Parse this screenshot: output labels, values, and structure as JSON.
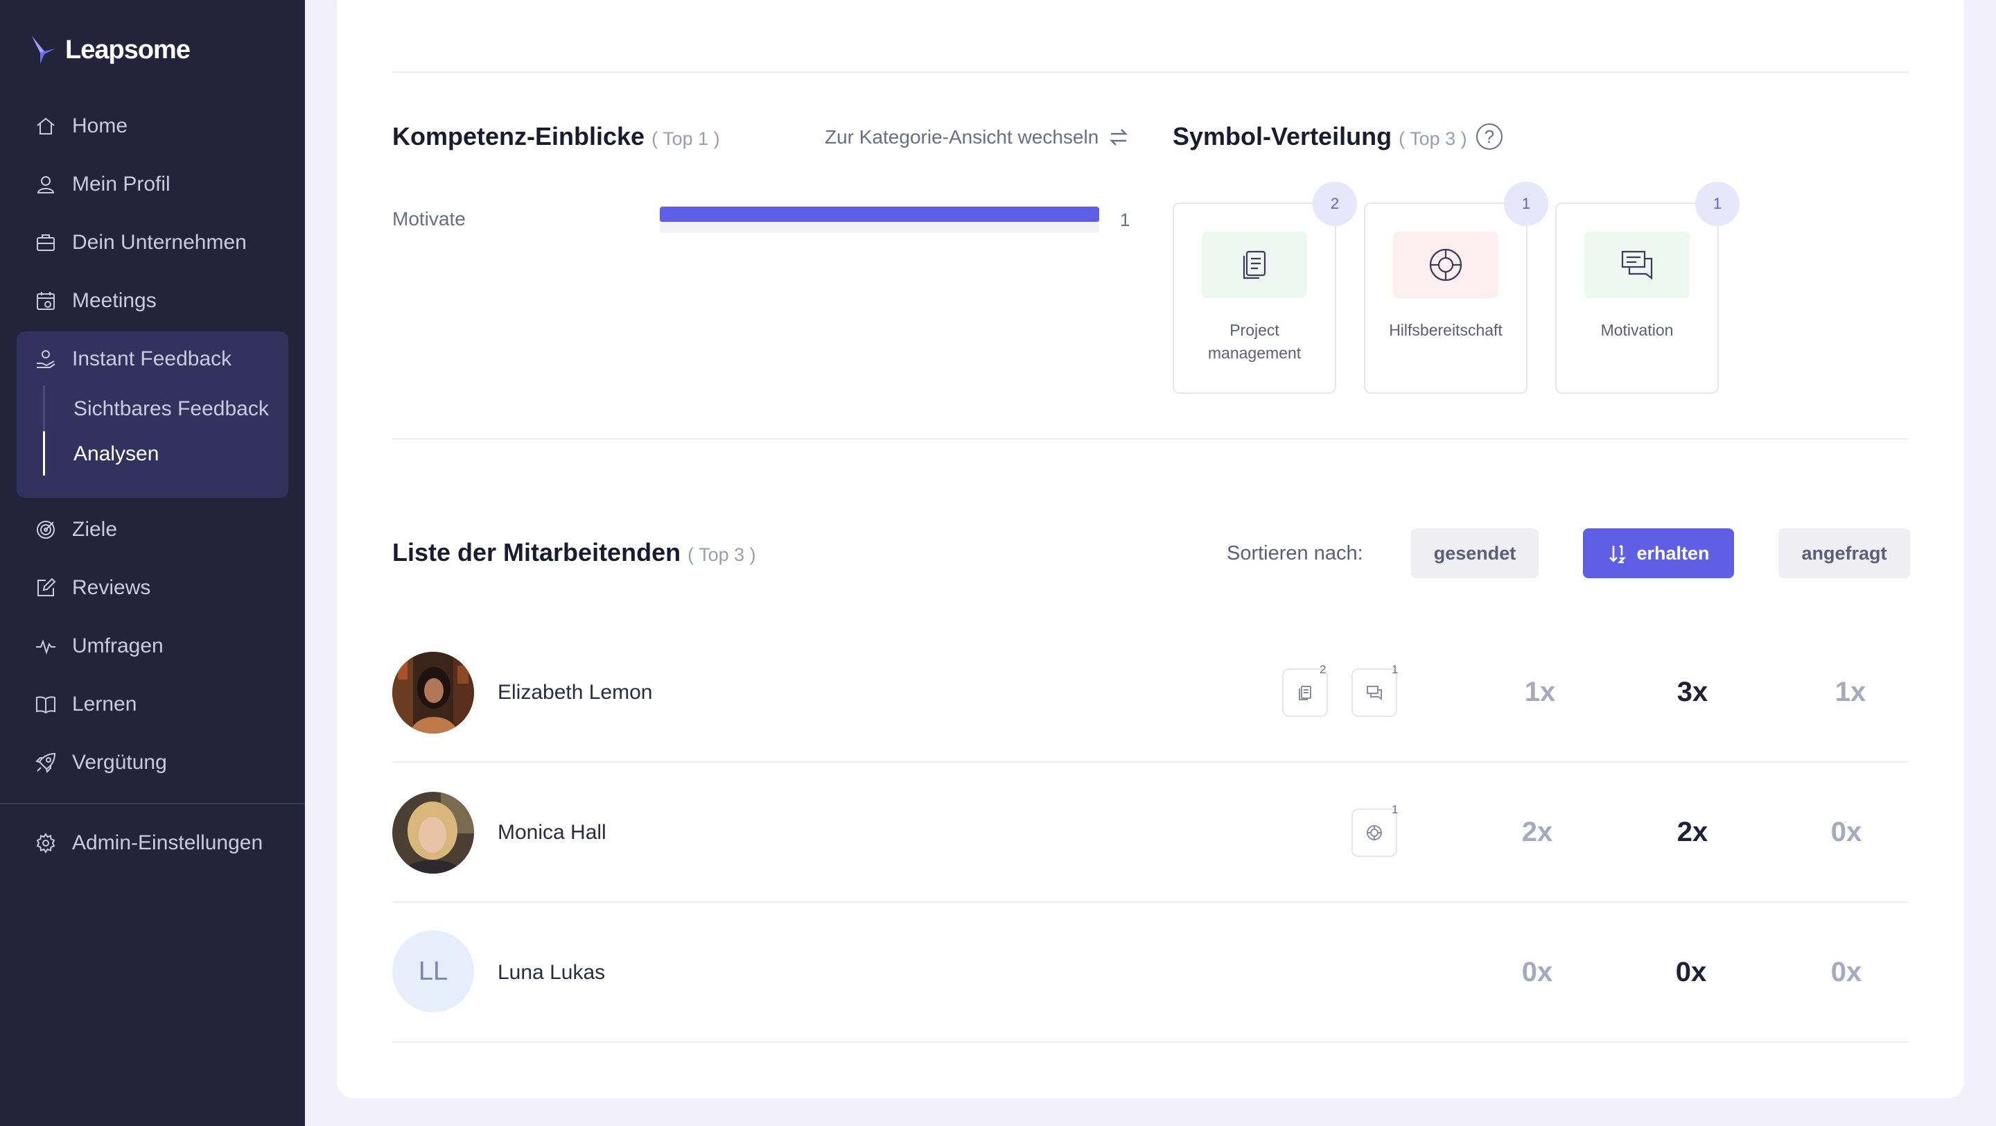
{
  "app": {
    "logo_text": "Leapsome"
  },
  "sidebar": {
    "items": [
      {
        "label": "Home"
      },
      {
        "label": "Mein Profil"
      },
      {
        "label": "Dein Unternehmen"
      },
      {
        "label": "Meetings"
      },
      {
        "label": "Instant Feedback"
      },
      {
        "label": "Ziele"
      },
      {
        "label": "Reviews"
      },
      {
        "label": "Umfragen"
      },
      {
        "label": "Lernen"
      },
      {
        "label": "Vergütung"
      }
    ],
    "subitems": [
      {
        "label": "Sichtbares Feedback"
      },
      {
        "label": "Analysen"
      }
    ],
    "admin": {
      "label": "Admin-Einstellungen"
    }
  },
  "competence": {
    "title": "Kompetenz-Einblicke",
    "subtitle": "( Top 1 )",
    "switch_label": "Zur Kategorie-Ansicht wechseln",
    "items": [
      {
        "label": "Motivate",
        "value": 1,
        "fraction": 1.0
      }
    ]
  },
  "symbols": {
    "title": "Symbol-Verteilung",
    "subtitle": "( Top 3 )",
    "help": "?",
    "tiles": [
      {
        "label": "Project management",
        "count": 2,
        "icon": "document-icon",
        "bg": "#eef8f3"
      },
      {
        "label": "Hilfsbereitschaft",
        "count": 1,
        "icon": "lifebuoy-icon",
        "bg": "#fbefef"
      },
      {
        "label": "Motivation",
        "count": 1,
        "icon": "chat-icon",
        "bg": "#eef8f3"
      }
    ]
  },
  "employees": {
    "title": "Liste der Mitarbeitenden",
    "subtitle": "( Top 3 )",
    "sort_label": "Sortieren nach:",
    "sort_buttons": {
      "sent": "gesendet",
      "received": "erhalten",
      "requested": "angefragt"
    },
    "rows": [
      {
        "name": "Elizabeth Lemon",
        "sent": "1x",
        "received": "3x",
        "requested": "1x",
        "badges": [
          {
            "icon": "document-icon",
            "count": "2"
          },
          {
            "icon": "chat-icon",
            "count": "1"
          }
        ]
      },
      {
        "name": "Monica Hall",
        "sent": "2x",
        "received": "2x",
        "requested": "0x",
        "badges": [
          {
            "icon": "lifebuoy-icon",
            "count": "1"
          }
        ]
      },
      {
        "name": "Luna Lukas",
        "initials": "LL",
        "sent": "0x",
        "received": "0x",
        "requested": "0x",
        "badges": []
      }
    ]
  },
  "colors": {
    "accent": "#5f5fe6",
    "sidebar_bg": "#23233b",
    "sidebar_active": "#31325e"
  }
}
